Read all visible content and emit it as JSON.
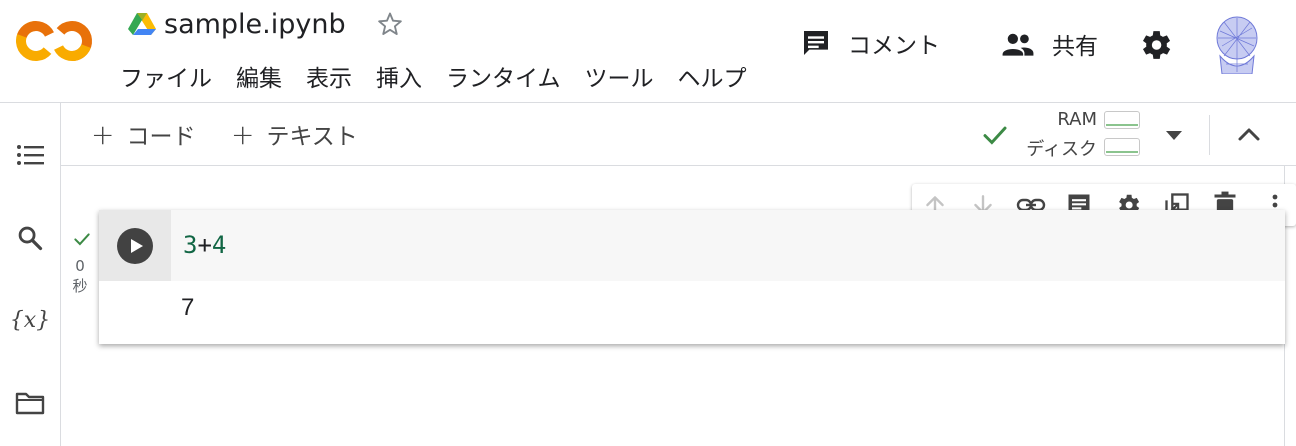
{
  "header": {
    "title": "sample.ipynb",
    "menu": [
      "ファイル",
      "編集",
      "表示",
      "挿入",
      "ランタイム",
      "ツール",
      "ヘルプ"
    ],
    "comment_label": "コメント",
    "share_label": "共有",
    "icons": {
      "logo": "colab-logo",
      "drive": "drive-icon",
      "star": "star-icon",
      "comment": "comment-icon",
      "share": "people-icon",
      "settings": "gear-icon",
      "avatar": "avatar"
    }
  },
  "toolbar": {
    "add_code": "コード",
    "add_text": "テキスト",
    "ram_label": "RAM",
    "disk_label": "ディスク"
  },
  "sidebar": {
    "icons": [
      "toc-icon",
      "search-icon",
      "variables-icon",
      "folder-icon"
    ],
    "variables_glyph": "{x}"
  },
  "cell": {
    "code": {
      "left": "3",
      "op": "+",
      "right": "4"
    },
    "output": "7",
    "exec_time_value": "0",
    "exec_time_unit": "秒"
  },
  "cell_toolbar": {
    "icons": [
      "arrow-up-icon",
      "arrow-down-icon",
      "link-icon",
      "comment-icon",
      "gear-icon",
      "mirror-cell-icon",
      "trash-icon",
      "more-vert-icon"
    ]
  },
  "colors": {
    "accent_green": "#116644",
    "check_green": "#3c8a45",
    "logo_orange": "#e8710a",
    "logo_yellow": "#f9ab00"
  }
}
